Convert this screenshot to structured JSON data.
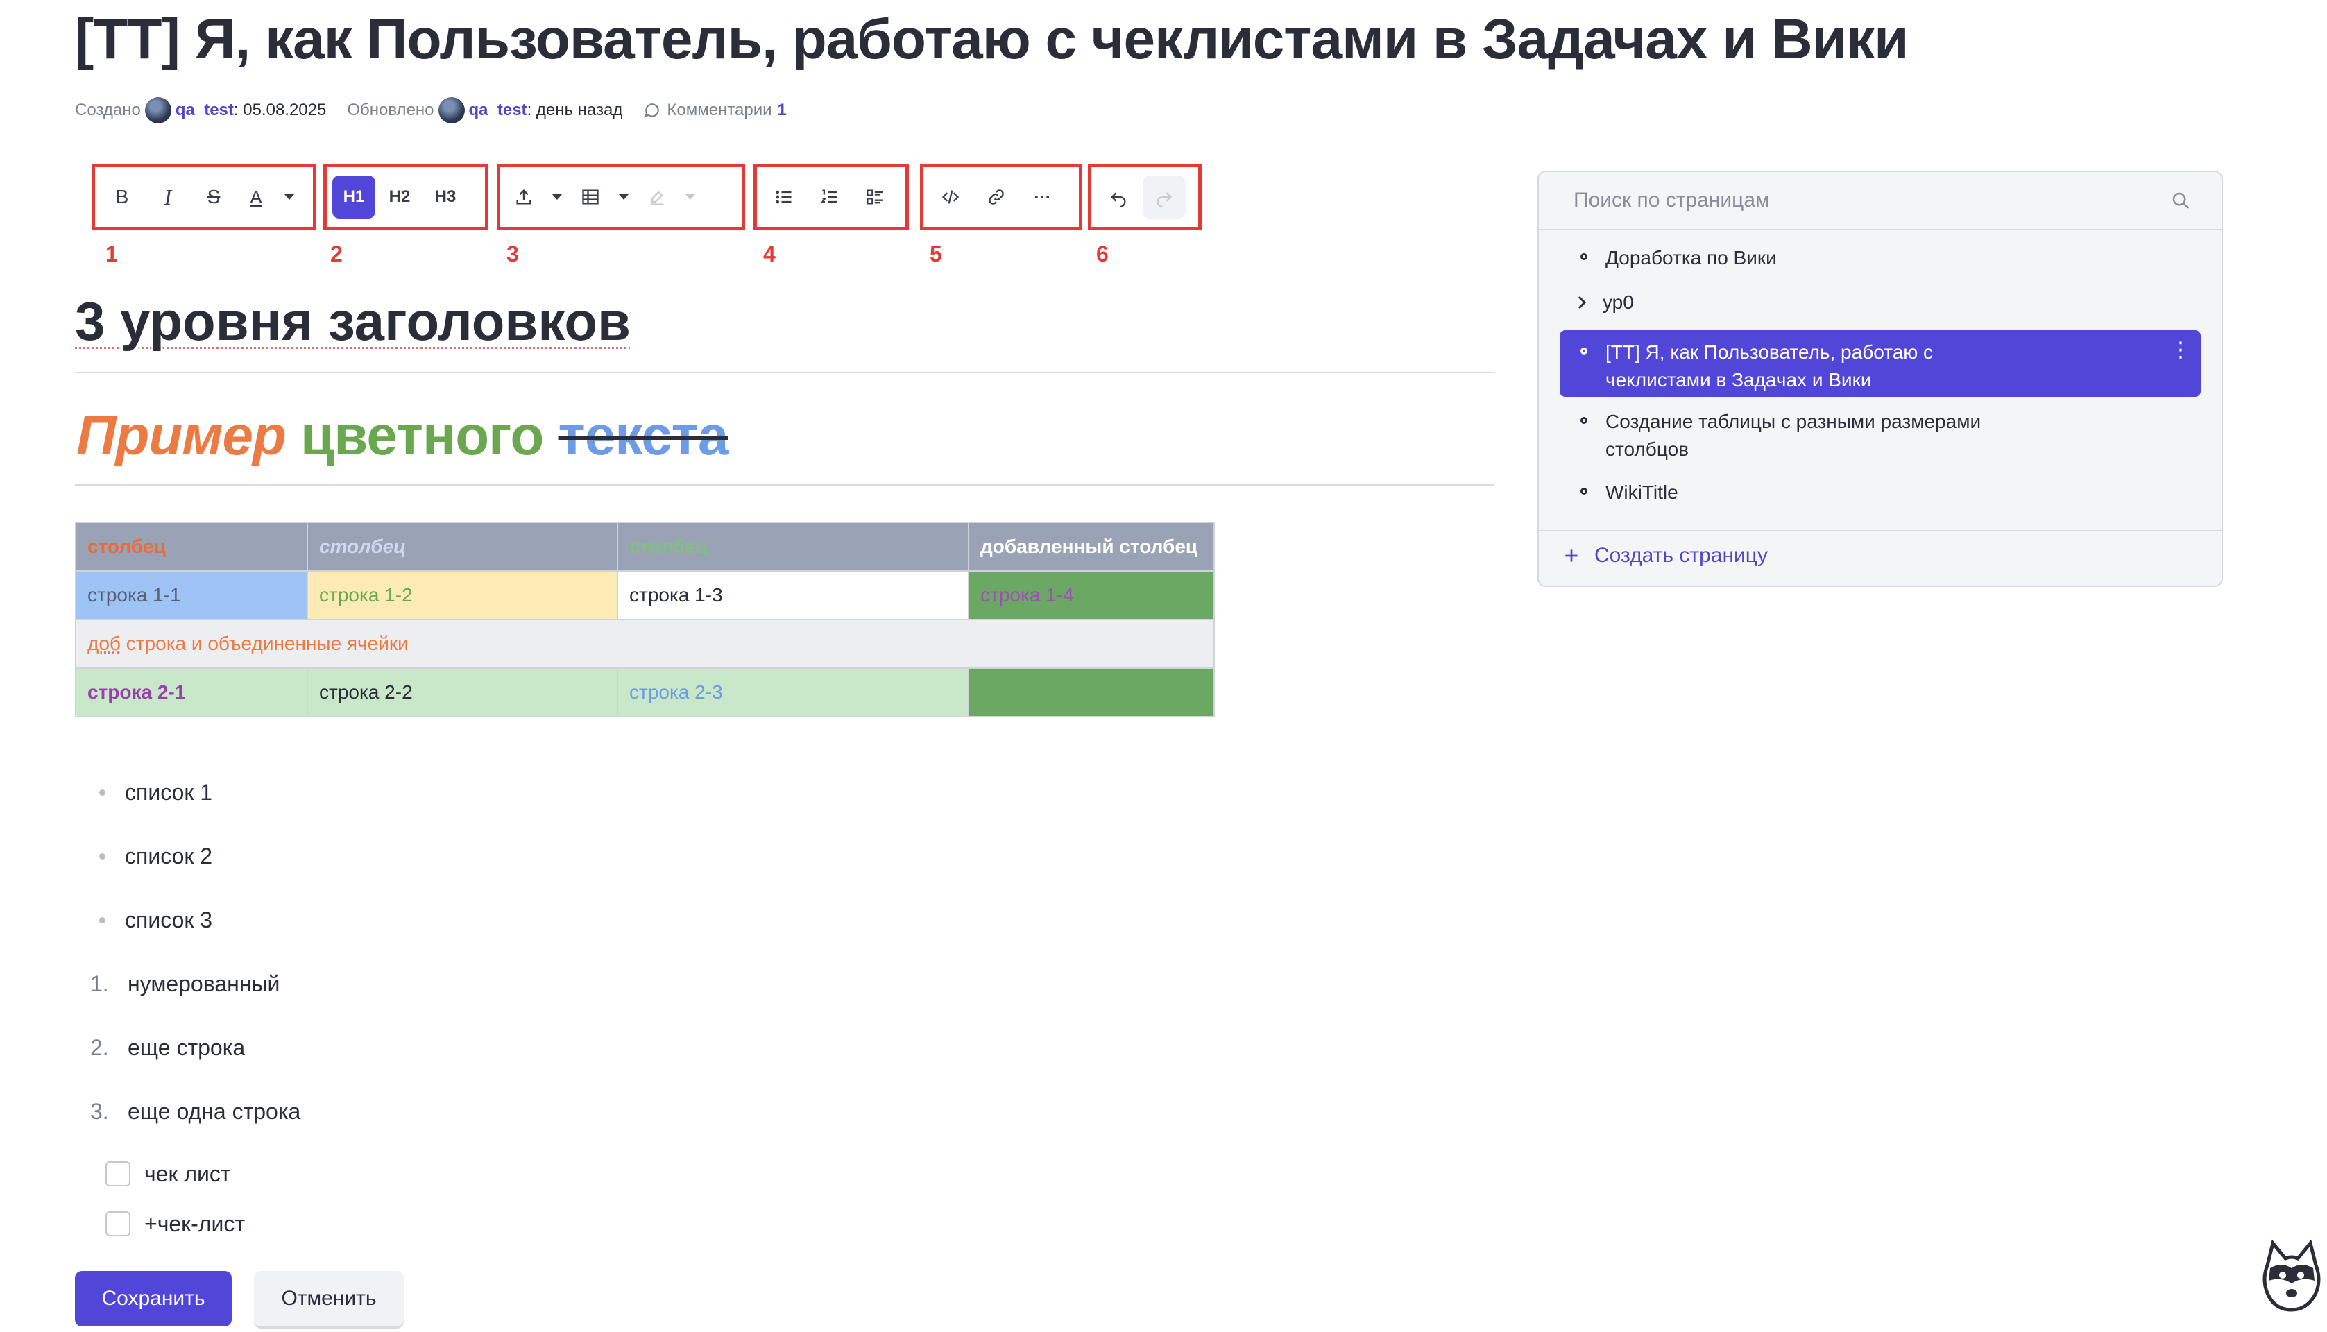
{
  "page": {
    "title": "[ТТ] Я, как Пользователь, работаю с чеклистами в Задачах и Вики"
  },
  "meta": {
    "created_label": "Создано",
    "created_user": "qa_test",
    "created_date": ": 05.08.2025",
    "updated_label": "Обновлено",
    "updated_user": "qa_test",
    "updated_when": ": день назад",
    "comments_label": "Комментарии",
    "comments_count": "1"
  },
  "toolbar": {
    "group_numbers": [
      "1",
      "2",
      "3",
      "4",
      "5",
      "6"
    ],
    "bold": "B",
    "h1": "H1",
    "h2": "H2",
    "h3": "H3",
    "icons": [
      "bold-icon",
      "italic-icon",
      "strikethrough-icon",
      "text-color-icon",
      "chevron-down-icon",
      "heading-1-icon",
      "heading-2-icon",
      "heading-3-icon",
      "upload-icon",
      "table-icon",
      "highlight-icon",
      "bullet-list-icon",
      "numbered-list-icon",
      "checklist-icon",
      "code-icon",
      "link-icon",
      "more-icon",
      "undo-icon",
      "redo-icon"
    ]
  },
  "content": {
    "heading": "3 уровня заголовков",
    "colored_words": [
      "Пример",
      "цветного",
      "текста"
    ],
    "table": {
      "header": [
        "столбец",
        "столбец",
        "столбец",
        "добавленный столбец"
      ],
      "row1": [
        "строка 1-1",
        "строка 1-2",
        "строка 1-3",
        "строка 1-4"
      ],
      "merged_prefix": "доб",
      "merged_rest": " строка и объединенные ячейки",
      "row3": [
        "строка 2-1",
        "строка 2-2",
        "строка 2-3",
        ""
      ]
    },
    "bullets": [
      "список 1",
      "список 2",
      "список 3"
    ],
    "numbered": [
      {
        "n": "1.",
        "text": "нумерованный"
      },
      {
        "n": "2.",
        "text": "еще строка"
      },
      {
        "n": "3.",
        "text": "еще одна строка"
      }
    ],
    "checklist": [
      "чек лист",
      "+чек-лист"
    ]
  },
  "actions": {
    "save": "Сохранить",
    "cancel": "Отменить"
  },
  "sidebar": {
    "search_placeholder": "Поиск по страницам",
    "items": [
      "Доработка по Вики",
      "ур0",
      "[ТТ] Я, как Пользователь, работаю с чеклистами в Задачах и Вики",
      "Создание таблицы с разными размерами столбцов",
      "WikiTitle"
    ],
    "create_label": "Создать страницу"
  },
  "colors": {
    "accent": "#5146d8",
    "annotation_red": "#e53935",
    "header_gray": "#9aa3b5",
    "cell_blue": "#9ec3f5",
    "cell_yellow": "#fcebb5",
    "cell_green_dark": "#6aa864",
    "cell_green_light": "#c8e8c9",
    "text_orange": "#ec7a43",
    "text_green": "#6aa84f",
    "text_blue": "#6e9be6",
    "text_purple": "#9b3fb0"
  }
}
